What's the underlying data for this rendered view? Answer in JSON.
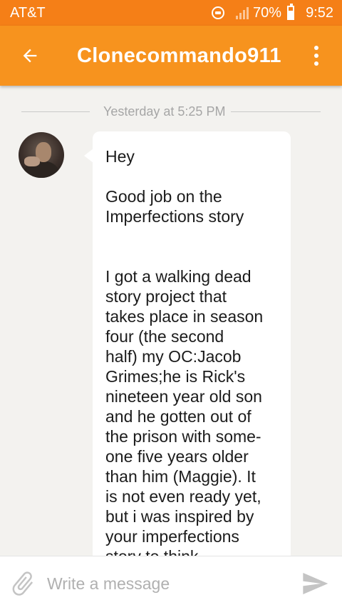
{
  "status_bar": {
    "carrier": "AT&T",
    "battery": "70%",
    "time": "9:52"
  },
  "header": {
    "title": "Clonecommando911",
    "back_icon": "arrow-left-icon",
    "menu_icon": "more-vertical-icon"
  },
  "conversation": {
    "date_divider": "Yesterday at 5:25 PM",
    "message": {
      "lines": [
        "Hey",
        "",
        "Good job on the",
        "Imperfections story",
        "",
        "",
        "I got a walking dead",
        "story project that",
        "takes place in season",
        "four (the second",
        "half) my OC:Jacob",
        "Grimes;he is Rick's",
        "nineteen year old son",
        "and he gotten out of",
        "the prison with some-",
        "one five years older",
        "than him (Maggie). It",
        "is not even ready yet,",
        "but i was inspired by",
        "your imperfections",
        "story to think"
      ]
    }
  },
  "composer": {
    "placeholder": "Write a message",
    "attach_icon": "paperclip-icon",
    "send_icon": "send-icon"
  },
  "colors": {
    "status_bar": "#f57f17",
    "app_bar": "#f7931e",
    "background": "#f3f2ef",
    "bubble": "#ffffff"
  }
}
